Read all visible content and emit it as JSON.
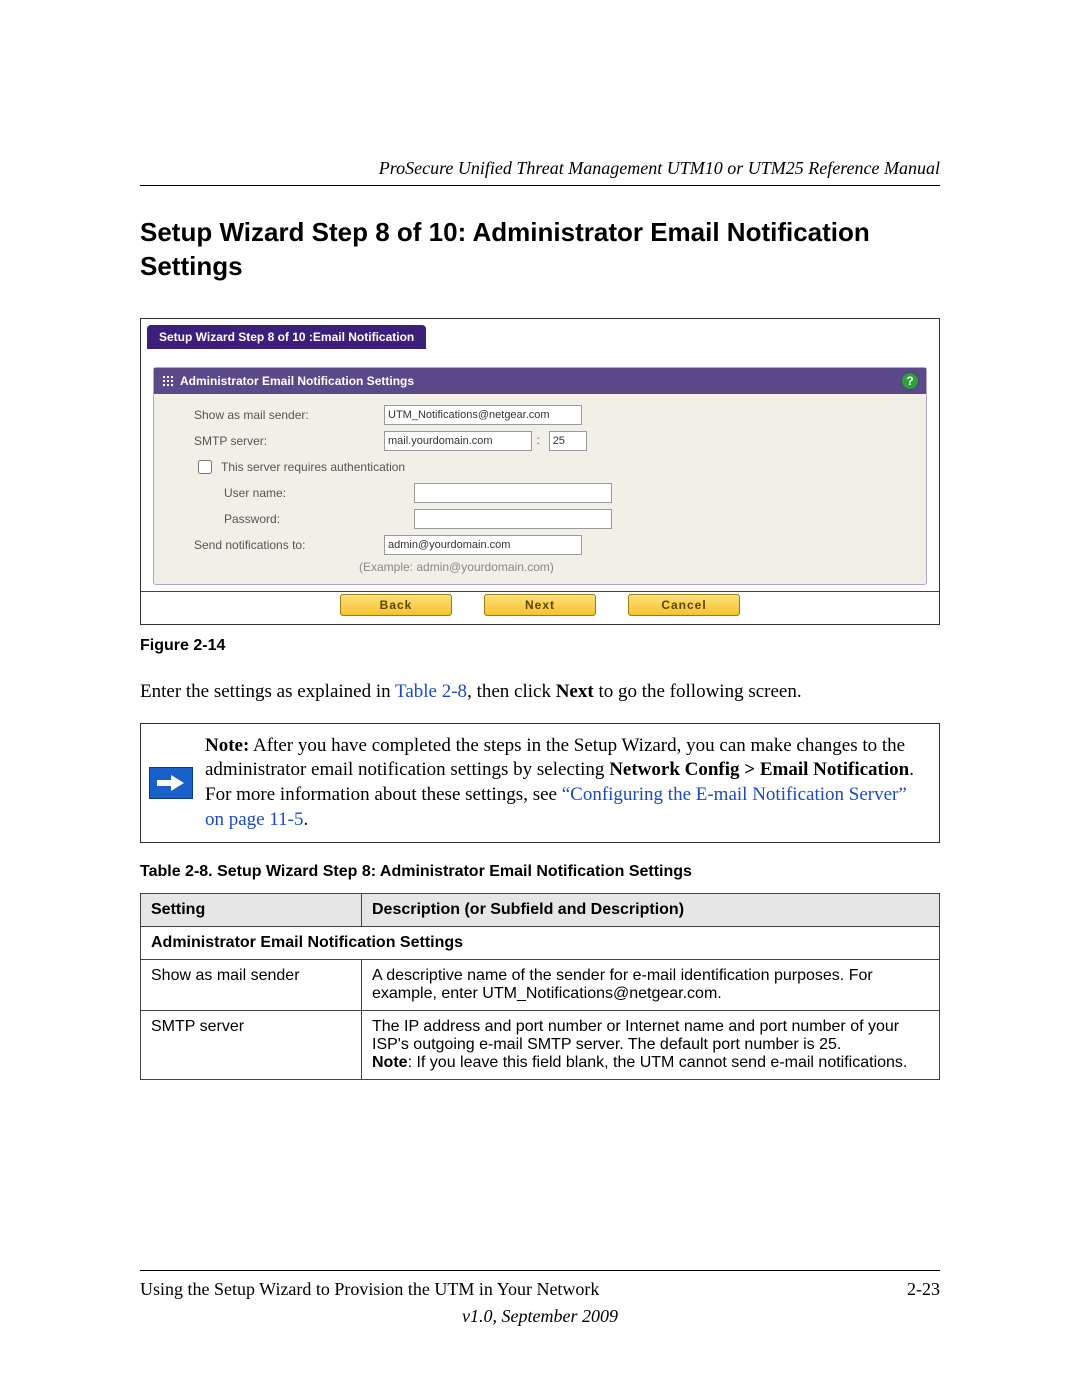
{
  "running_header": "ProSecure Unified Threat Management UTM10 or UTM25 Reference Manual",
  "section_title": "Setup Wizard Step 8 of 10: Administrator Email Notification Settings",
  "screenshot": {
    "tab_title": "Setup Wizard Step 8 of 10 :Email Notification",
    "panel_title": "Administrator Email Notification Settings",
    "labels": {
      "sender": "Show as mail sender:",
      "smtp": "SMTP server:",
      "auth_checkbox": "This server requires authentication",
      "username": "User name:",
      "password": "Password:",
      "send_to": "Send notifications to:",
      "example": "(Example: admin@yourdomain.com)"
    },
    "values": {
      "sender": "UTM_Notifications@netgear.com",
      "smtp_host": "mail.yourdomain.com",
      "smtp_sep": ":",
      "smtp_port": "25",
      "username": "",
      "password": "",
      "send_to": "admin@yourdomain.com"
    },
    "buttons": {
      "back": "Back",
      "next": "Next",
      "cancel": "Cancel"
    }
  },
  "figure_caption": "Figure 2-14",
  "para1": {
    "t1": "Enter the settings as explained in ",
    "link": "Table 2-8",
    "t2": ", then click ",
    "bold": "Next",
    "t3": " to go the following screen."
  },
  "note": {
    "lead": "Note:",
    "t1": " After you have completed the steps in the Setup Wizard, you can make changes to the administrator email notification settings by selecting ",
    "bold1": "Network Config > Email Notification",
    "t2": ". For more information about these settings, see ",
    "link": "“Configuring the E-mail Notification Server” on page 11-5",
    "t3": "."
  },
  "table_caption": "Table 2-8.  Setup Wizard Step 8: Administrator Email Notification Settings",
  "table": {
    "h1": "Setting",
    "h2": "Description (or Subfield and Description)",
    "subhead": "Administrator Email Notification Settings",
    "r1c1": "Show as mail sender",
    "r1c2": "A descriptive name of the sender for e-mail identification purposes. For example, enter UTM_Notifications@netgear.com.",
    "r2c1": "SMTP server",
    "r2c2a": "The IP address and port number or Internet name and port number of your ISP's outgoing e-mail SMTP server. The default port number is 25.",
    "r2c2_bold": "Note",
    "r2c2b": ": If you leave this field blank, the UTM cannot send e-mail notifications."
  },
  "footer": {
    "left": "Using the Setup Wizard to Provision the UTM in Your Network",
    "right": "2-23",
    "center": "v1.0, September 2009"
  }
}
